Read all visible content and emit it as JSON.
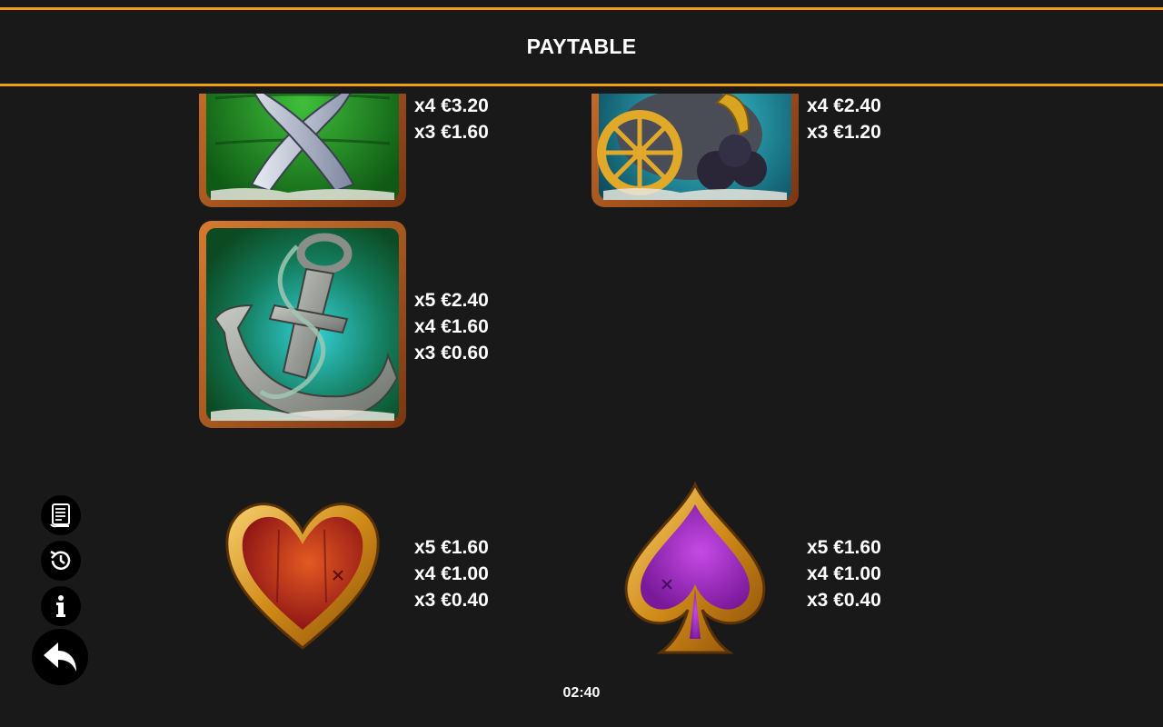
{
  "header": {
    "title": "PAYTABLE"
  },
  "symbols": [
    {
      "name": "crossed-swords",
      "pays": [
        "x4 €3.20",
        "x3 €1.60"
      ]
    },
    {
      "name": "cannon",
      "pays": [
        "x4 €2.40",
        "x3 €1.20"
      ]
    },
    {
      "name": "anchor",
      "pays": [
        "x5 €2.40",
        "x4 €1.60",
        "x3 €0.60"
      ]
    },
    {
      "name": "heart",
      "pays": [
        "x5 €1.60",
        "x4 €1.00",
        "x3 €0.40"
      ]
    },
    {
      "name": "spade",
      "pays": [
        "x5 €1.60",
        "x4 €1.00",
        "x3 €0.40"
      ]
    }
  ],
  "sidebar": {
    "buttons": [
      "rules-icon",
      "history-icon",
      "info-icon",
      "back-icon"
    ]
  },
  "footer": {
    "clock": "02:40"
  },
  "colors": {
    "accent": "#f29b16",
    "background": "#191919"
  }
}
